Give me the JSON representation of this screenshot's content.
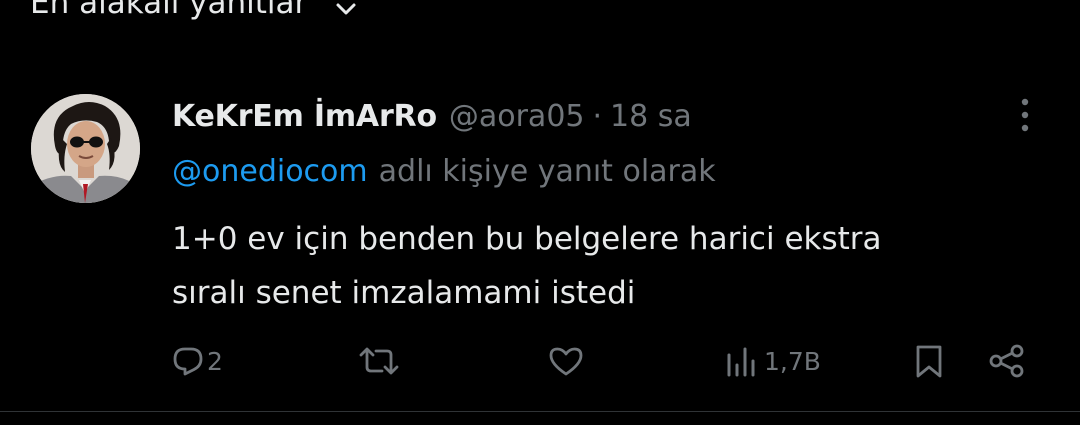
{
  "top": {
    "sort_label": "En alakalı yanıtlar",
    "icon": "chevron-down-icon"
  },
  "tweet": {
    "author_name": "KeKrEm İmArRo",
    "author_handle": "@aora05",
    "separator": "·",
    "time": "18 sa",
    "reply_to_mention": "@onediocom",
    "reply_to_suffix": "adlı kişiye yanıt olarak",
    "text_line1": "1+0 ev için benden bu belgelere harici ekstra",
    "text_line2": "sıralı senet imzalamami istedi"
  },
  "actions": {
    "reply_count": "2",
    "repost_count": "",
    "like_count": "",
    "views_count": "1,7B",
    "icons": [
      "reply-icon",
      "repost-icon",
      "like-icon",
      "views-icon",
      "bookmark-icon",
      "share-icon"
    ]
  },
  "colors": {
    "background": "#000000",
    "text": "#e7e9ea",
    "secondary": "#71767b",
    "accent": "#1d9bf0",
    "divider": "#2f3336"
  }
}
